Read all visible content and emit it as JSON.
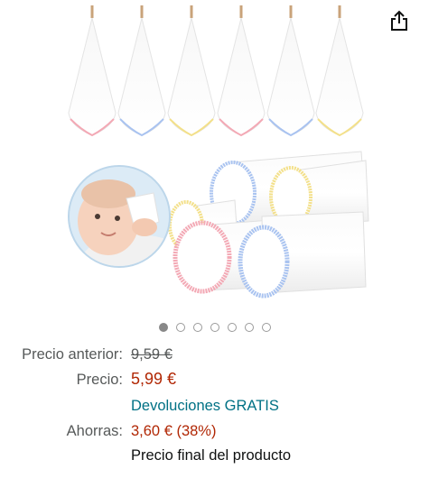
{
  "gallery": {
    "image_description_icon": "baby-washcloths-image",
    "dot_count": 7,
    "active_index": 0
  },
  "toolbar": {
    "share_icon": "share-icon"
  },
  "pricing": {
    "previous_label": "Precio anterior:",
    "previous_value": "9,59 €",
    "price_label": "Precio:",
    "price_value": "5,99 €",
    "returns_text": "Devoluciones GRATIS",
    "savings_label": "Ahorras:",
    "savings_value": "3,60 € (38%)",
    "final_price_text": "Precio final del producto"
  },
  "colors": {
    "price": "#b12704",
    "link": "#007185",
    "muted": "#565959"
  }
}
